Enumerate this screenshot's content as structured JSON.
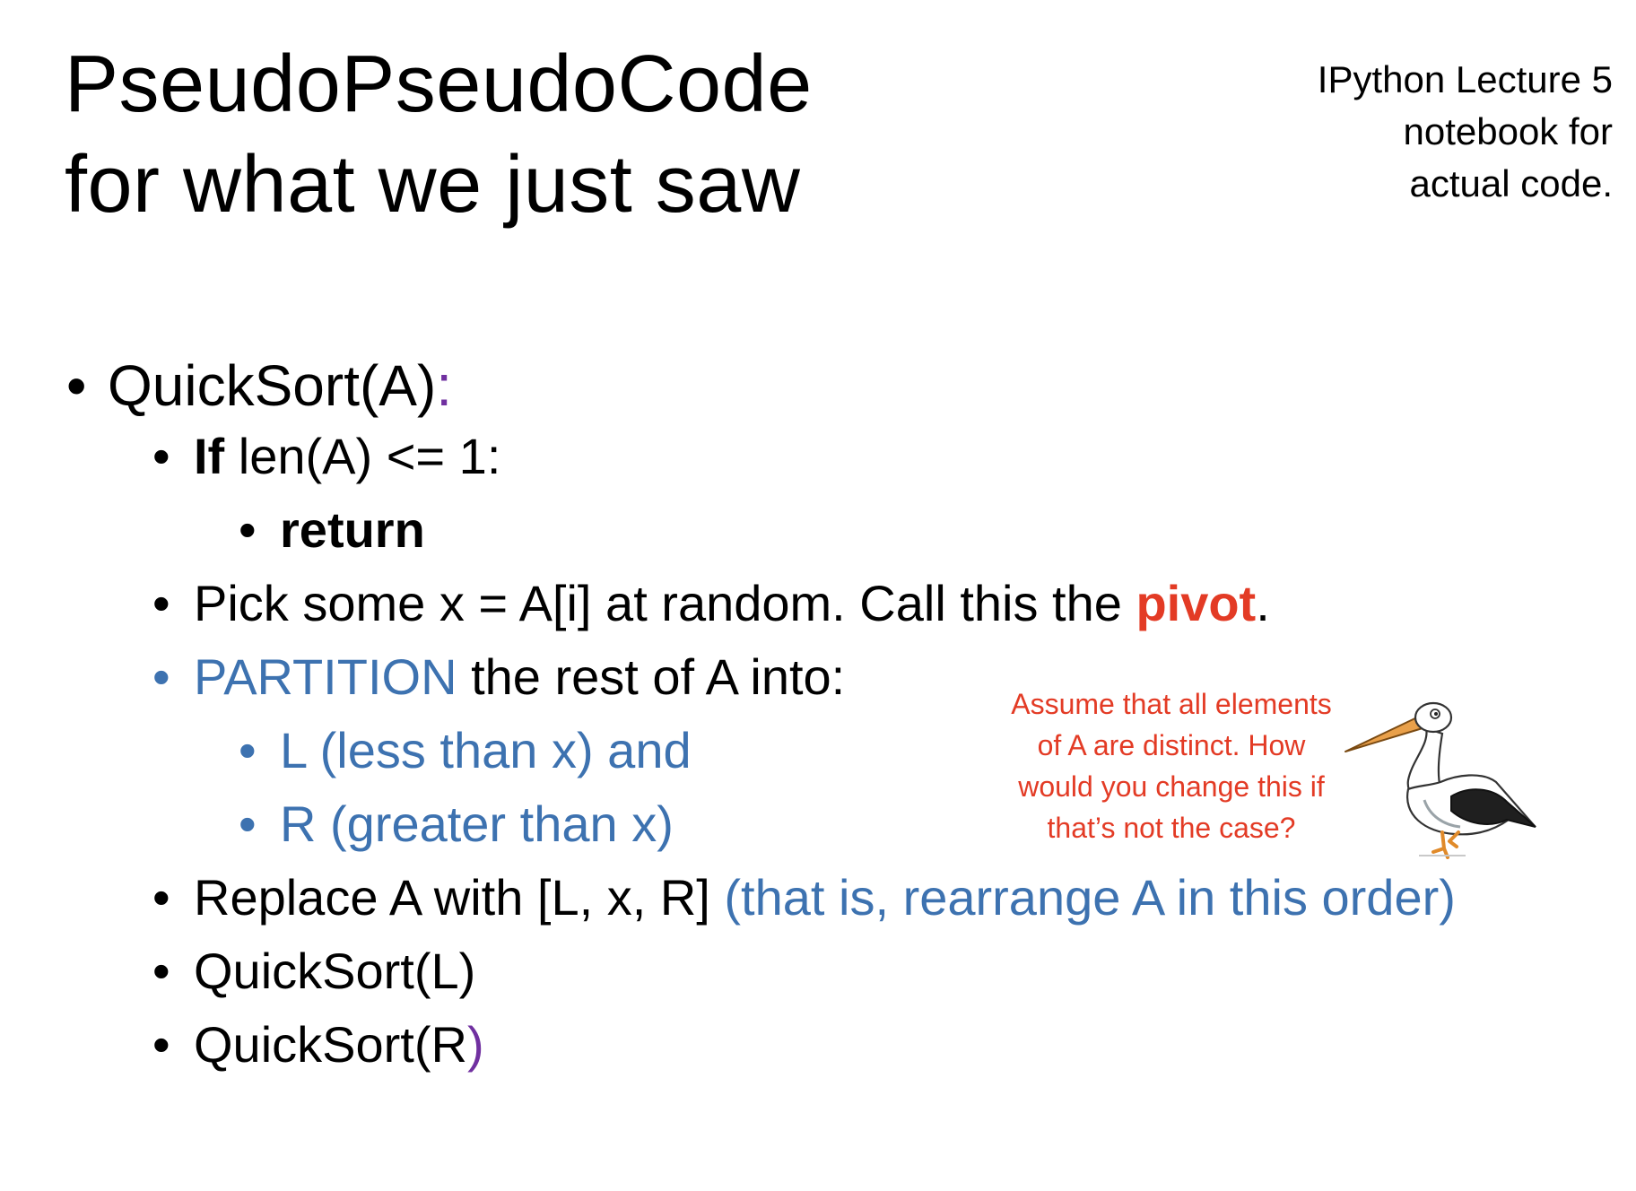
{
  "title": {
    "line1": "PseudoPseudoCode",
    "line2": "for what we just saw"
  },
  "side_note": {
    "line1": "IPython Lecture 5",
    "line2": "notebook for",
    "line3": "actual code."
  },
  "bullets": {
    "quicksort_def": {
      "text": "QuickSort(A)",
      "colon": ":"
    },
    "if_line": {
      "keyword": "If",
      "rest": " len(A) <= 1:"
    },
    "return_line": {
      "text": "return"
    },
    "pick_line": {
      "text": "Pick some x = A[i] at random.  Call this the ",
      "pivot": "pivot",
      "end": "."
    },
    "partition_line": {
      "keyword": "PARTITION",
      "rest": " the rest of A into:"
    },
    "l_line": {
      "text": "L (less than x) and"
    },
    "r_line": {
      "text": "R (greater than x)"
    },
    "replace_line": {
      "text": "Replace A with  [L, x, R]  ",
      "note": "(that is, rearrange A in this order)"
    },
    "recurse_l": {
      "text": "QuickSort(L)"
    },
    "recurse_r": {
      "text": "QuickSort(R",
      "paren": ")"
    }
  },
  "callout": {
    "line1": "Assume that all elements",
    "line2": "of A are distinct.  How",
    "line3": "would you change this if",
    "line4": "that’s not the case?"
  },
  "colors": {
    "accent_blue": "#3d72b0",
    "accent_red": "#e33b25",
    "accent_purple": "#7030a0"
  },
  "icons": {
    "bullet": "•",
    "bird": "stork-illustration"
  }
}
